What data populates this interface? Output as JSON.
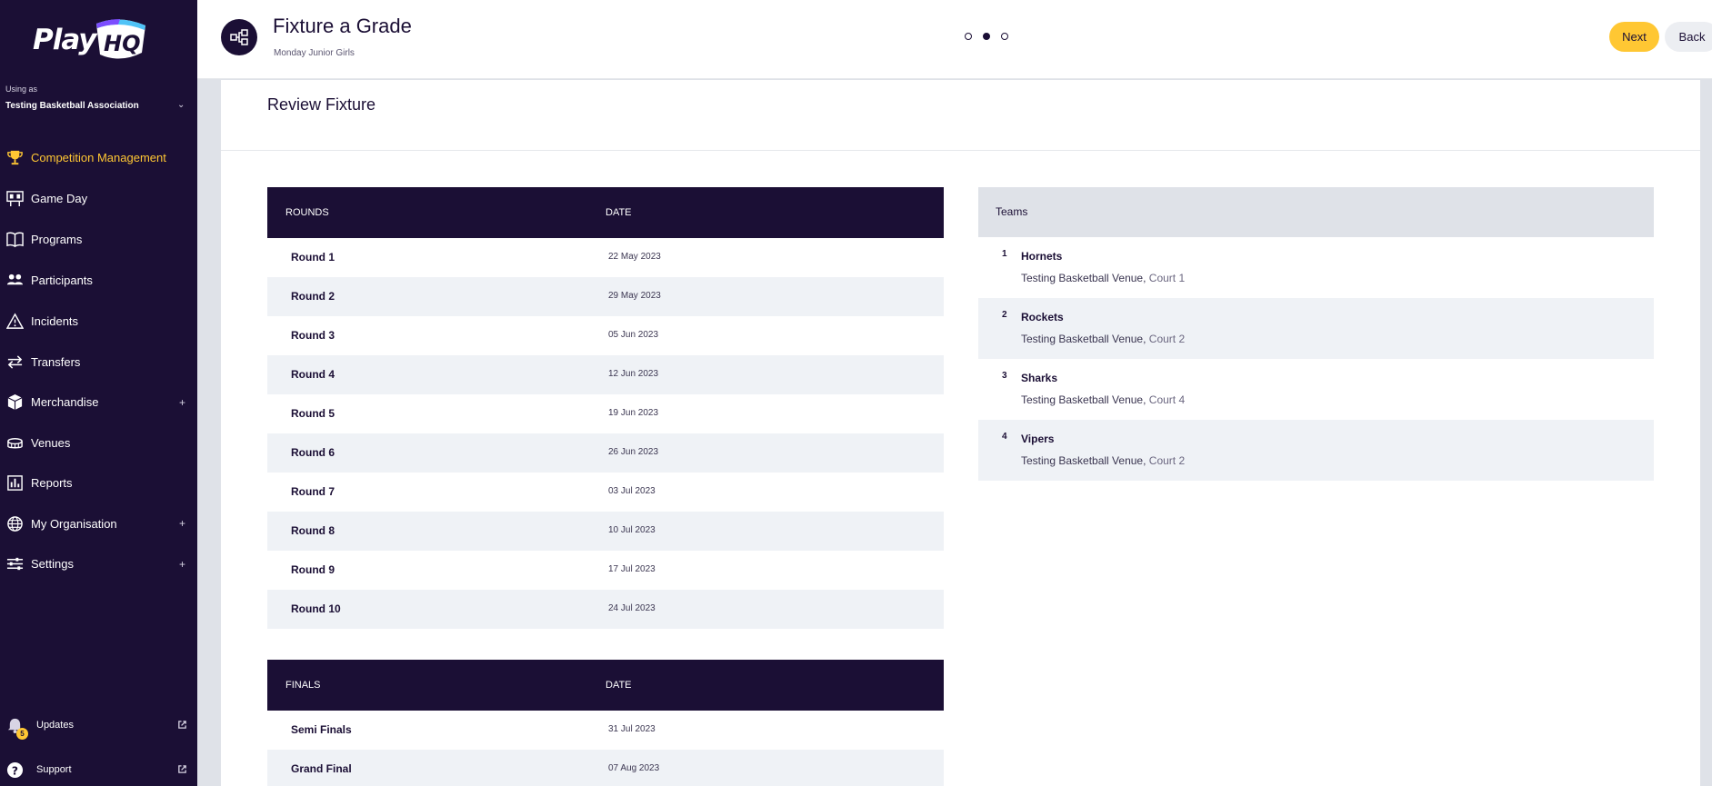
{
  "brand": {
    "logo_text_play": "Play",
    "logo_text_hq": "HQ",
    "accent": "#ffc733",
    "navy": "#1b0f35"
  },
  "sidebar": {
    "using_as_label": "Using as",
    "org_name": "Testing Basketball Association",
    "items": [
      {
        "label": "Competition Management",
        "icon": "trophy-icon",
        "active": true,
        "expandable": false
      },
      {
        "label": "Game Day",
        "icon": "scoreboard-icon",
        "active": false,
        "expandable": false
      },
      {
        "label": "Programs",
        "icon": "book-icon",
        "active": false,
        "expandable": false
      },
      {
        "label": "Participants",
        "icon": "people-icon",
        "active": false,
        "expandable": false
      },
      {
        "label": "Incidents",
        "icon": "warning-icon",
        "active": false,
        "expandable": false
      },
      {
        "label": "Transfers",
        "icon": "transfer-icon",
        "active": false,
        "expandable": false
      },
      {
        "label": "Merchandise",
        "icon": "box-icon",
        "active": false,
        "expandable": true
      },
      {
        "label": "Venues",
        "icon": "stadium-icon",
        "active": false,
        "expandable": false
      },
      {
        "label": "Reports",
        "icon": "report-icon",
        "active": false,
        "expandable": false
      },
      {
        "label": "My Organisation",
        "icon": "globe-icon",
        "active": false,
        "expandable": true
      },
      {
        "label": "Settings",
        "icon": "sliders-icon",
        "active": false,
        "expandable": true
      }
    ],
    "expand_symbol": "+",
    "updates_label": "Updates",
    "updates_badge": "5",
    "support_label": "Support"
  },
  "header": {
    "title": "Fixture a Grade",
    "subtitle": "Monday Junior Girls",
    "steps": 3,
    "active_step": 2,
    "next_label": "Next",
    "back_label": "Back"
  },
  "main": {
    "title": "Review Fixture",
    "rounds": {
      "headers": [
        "ROUNDS",
        "DATE"
      ],
      "rows": [
        {
          "name": "Round 1",
          "date": "22 May 2023"
        },
        {
          "name": "Round 2",
          "date": "29 May 2023"
        },
        {
          "name": "Round 3",
          "date": "05 Jun 2023"
        },
        {
          "name": "Round 4",
          "date": "12 Jun 2023"
        },
        {
          "name": "Round 5",
          "date": "19 Jun 2023"
        },
        {
          "name": "Round 6",
          "date": "26 Jun 2023"
        },
        {
          "name": "Round 7",
          "date": "03 Jul 2023"
        },
        {
          "name": "Round 8",
          "date": "10 Jul 2023"
        },
        {
          "name": "Round 9",
          "date": "17 Jul 2023"
        },
        {
          "name": "Round 10",
          "date": "24 Jul 2023"
        }
      ]
    },
    "finals": {
      "headers": [
        "FINALS",
        "DATE"
      ],
      "rows": [
        {
          "name": "Semi Finals",
          "date": "31 Jul 2023"
        },
        {
          "name": "Grand Final",
          "date": "07 Aug 2023"
        }
      ]
    },
    "teams": {
      "header": "Teams",
      "rows": [
        {
          "num": "1",
          "name": "Hornets",
          "venue": "Testing Basketball Venue,",
          "court": "Court 1"
        },
        {
          "num": "2",
          "name": "Rockets",
          "venue": "Testing Basketball Venue,",
          "court": "Court 2"
        },
        {
          "num": "3",
          "name": "Sharks",
          "venue": "Testing Basketball Venue,",
          "court": "Court 4"
        },
        {
          "num": "4",
          "name": "Vipers",
          "venue": "Testing Basketball Venue,",
          "court": "Court 2"
        }
      ]
    }
  }
}
